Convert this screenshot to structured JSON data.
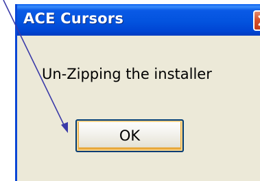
{
  "window": {
    "title": "ACE Cursors",
    "close_icon": "close-icon"
  },
  "dialog": {
    "message": "Un-Zipping the installer",
    "ok_label": "OK"
  },
  "annotation": {
    "arrow_icon": "arrow-icon",
    "arrow_color": "#3a3aa8"
  },
  "colors": {
    "titlebar": "#0353de",
    "dialog_bg": "#ece9d8",
    "close_button": "#d8532e"
  }
}
